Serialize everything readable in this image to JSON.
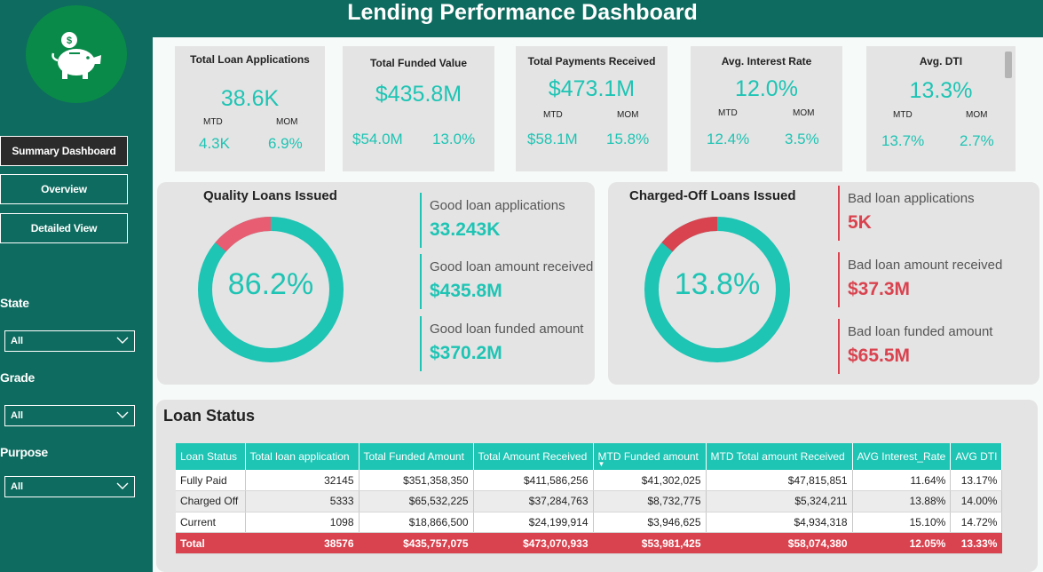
{
  "title": "Lending Performance Dashboard",
  "sidebar": {
    "nav": [
      "Summary Dashboard",
      "Overview",
      "Detailed View"
    ],
    "filters": [
      {
        "label": "State",
        "value": "All"
      },
      {
        "label": "Grade",
        "value": "All"
      },
      {
        "label": "Purpose",
        "value": "All"
      }
    ]
  },
  "kpis": [
    {
      "title": "Total  Loan Applications",
      "value": "38.6K",
      "mtd_label": "MTD",
      "mom_label": "MOM",
      "mtd": "4.3K",
      "mom": "6.9%"
    },
    {
      "title": "Total Funded Value",
      "value": "$435.8M",
      "mtd": "$54.0M",
      "mom": "13.0%"
    },
    {
      "title": "Total Payments Received",
      "value": "$473.1M",
      "mtd_label": "MTD",
      "mom_label": "MOM",
      "mtd": "$58.1M",
      "mom": "15.8%"
    },
    {
      "title": "Avg. Interest Rate",
      "value": "12.0%",
      "mtd_label": "MTD",
      "mom_label": "MOM",
      "mtd": "12.4%",
      "mom": "3.5%"
    },
    {
      "title": "Avg. DTI",
      "value": "13.3%",
      "mtd_label": "MTD",
      "mom_label": "MOM",
      "mtd": "13.7%",
      "mom": "2.7%"
    }
  ],
  "good": {
    "title": "Quality Loans Issued",
    "percent_label": "86.2%",
    "percent": 86.2,
    "metrics": [
      {
        "label": "Good loan applications",
        "value": "33.243K"
      },
      {
        "label": "Good loan amount received",
        "value": "$435.8M"
      },
      {
        "label": "Good loan funded amount",
        "value": "$370.2M"
      }
    ]
  },
  "bad": {
    "title": "Charged-Off Loans Issued",
    "percent_label": "13.8%",
    "percent": 13.8,
    "metrics": [
      {
        "label": "Bad loan applications",
        "value": "5K"
      },
      {
        "label": "Bad loan amount received",
        "value": "$37.3M"
      },
      {
        "label": "Bad loan funded amount",
        "value": "$65.5M"
      }
    ]
  },
  "colors": {
    "teal": "#1ec4b4",
    "red": "#d9434f",
    "pink": "#e85d72",
    "green": "#0e6b5f"
  },
  "loan_status": {
    "title": "Loan Status",
    "headers": [
      "Loan Status",
      "Total loan application",
      "Total Funded Amount",
      "Total Amount Received",
      "MTD Funded amount",
      "MTD Total amount Received",
      "AVG Interest_Rate",
      "AVG DTI"
    ],
    "rows": [
      [
        "Fully Paid",
        "32145",
        "$351,358,350",
        "$411,586,256",
        "$41,302,025",
        "$47,815,851",
        "11.64%",
        "13.17%"
      ],
      [
        "Charged Off",
        "5333",
        "$65,532,225",
        "$37,284,763",
        "$8,732,775",
        "$5,324,211",
        "13.88%",
        "14.00%"
      ],
      [
        "Current",
        "1098",
        "$18,866,500",
        "$24,199,914",
        "$3,946,625",
        "$4,934,318",
        "15.10%",
        "14.72%"
      ]
    ],
    "total": [
      "Total",
      "38576",
      "$435,757,075",
      "$473,070,933",
      "$53,981,425",
      "$58,074,380",
      "12.05%",
      "13.33%"
    ]
  }
}
